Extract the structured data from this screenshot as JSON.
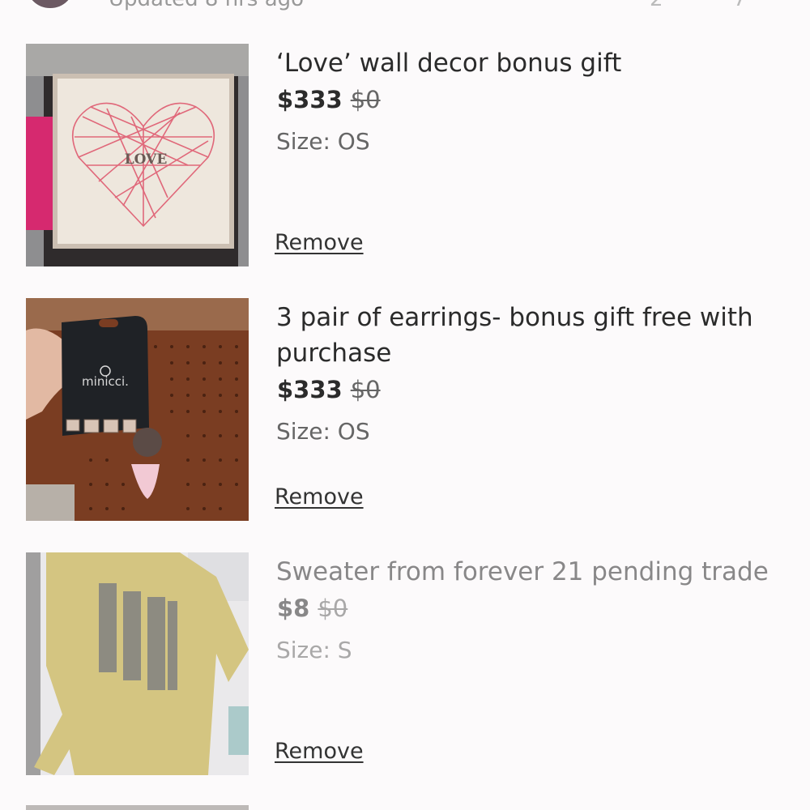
{
  "header": {
    "updated_text": "Updated 8 hrs ago",
    "count": "2",
    "arrow": "7"
  },
  "items": [
    {
      "title": "‘Love’ wall decor bonus gift",
      "price": "$333",
      "original_price": "$0",
      "size": "Size: OS",
      "remove_label": "Remove",
      "image_text": "LOVE"
    },
    {
      "title": "3 pair of earrings- bonus gift free with purchase",
      "price": "$333",
      "original_price": "$0",
      "size": "Size: OS",
      "remove_label": "Remove",
      "image_text": "minicci."
    },
    {
      "title": "Sweater from forever 21 pending trade",
      "price": "$8",
      "original_price": "$0",
      "size": "Size: S",
      "remove_label": "Remove"
    }
  ]
}
